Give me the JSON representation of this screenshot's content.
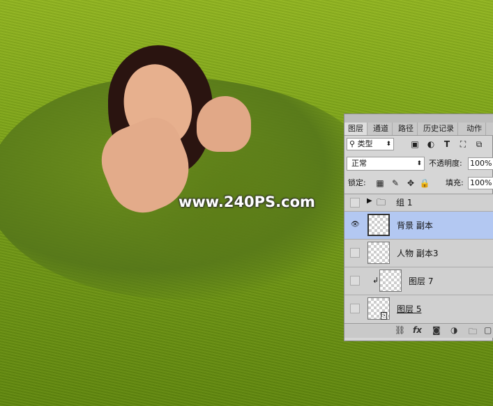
{
  "canvas": {
    "watermark": "www.240PS.com"
  },
  "panel": {
    "tabs": [
      {
        "label": "图层",
        "active": true
      },
      {
        "label": "通道",
        "active": false
      },
      {
        "label": "路径",
        "active": false
      },
      {
        "label": "历史记录",
        "active": false
      },
      {
        "label": "动作",
        "active": false
      }
    ],
    "filter": {
      "search_glyph": "⚲",
      "selected": "类型",
      "icons": [
        "image-filter-icon",
        "adjust-filter-icon",
        "type-filter-icon",
        "shape-filter-icon",
        "smart-filter-icon"
      ]
    },
    "blend_mode": "正常",
    "opacity_label": "不透明度:",
    "opacity_value": "100%",
    "lock_label": "锁定:",
    "fill_label": "填充:",
    "fill_value": "100%",
    "layers": [
      {
        "name": "组 1",
        "type": "group",
        "visible": false,
        "selected": false
      },
      {
        "name": "背景 副本",
        "type": "pixel",
        "visible": true,
        "selected": true
      },
      {
        "name": "人物 副本3",
        "type": "pixel",
        "visible": false,
        "selected": false
      },
      {
        "name": "图层 7",
        "type": "clipped",
        "visible": false,
        "selected": false
      },
      {
        "name": "图层 5",
        "type": "smart",
        "visible": false,
        "selected": false
      }
    ],
    "footer_icons": [
      "link-icon",
      "fx-icon",
      "mask-icon",
      "adjustment-icon",
      "folder-icon",
      "new-layer-icon"
    ]
  }
}
